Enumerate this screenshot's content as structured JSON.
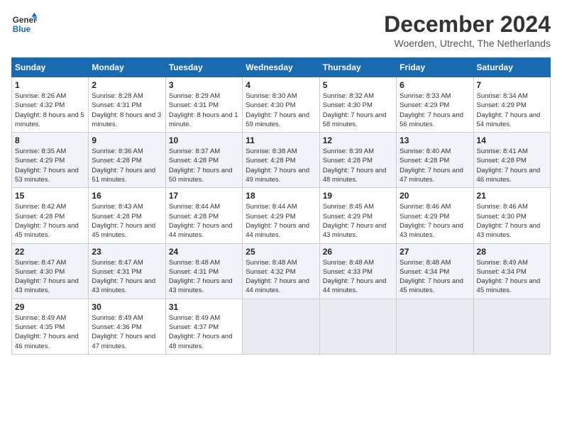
{
  "header": {
    "logo_line1": "General",
    "logo_line2": "Blue",
    "month_title": "December 2024",
    "location": "Woerden, Utrecht, The Netherlands"
  },
  "days_of_week": [
    "Sunday",
    "Monday",
    "Tuesday",
    "Wednesday",
    "Thursday",
    "Friday",
    "Saturday"
  ],
  "weeks": [
    [
      {
        "day": "1",
        "sunrise": "8:26 AM",
        "sunset": "4:32 PM",
        "daylight": "8 hours and 5 minutes."
      },
      {
        "day": "2",
        "sunrise": "8:28 AM",
        "sunset": "4:31 PM",
        "daylight": "8 hours and 3 minutes."
      },
      {
        "day": "3",
        "sunrise": "8:29 AM",
        "sunset": "4:31 PM",
        "daylight": "8 hours and 1 minute."
      },
      {
        "day": "4",
        "sunrise": "8:30 AM",
        "sunset": "4:30 PM",
        "daylight": "7 hours and 59 minutes."
      },
      {
        "day": "5",
        "sunrise": "8:32 AM",
        "sunset": "4:30 PM",
        "daylight": "7 hours and 58 minutes."
      },
      {
        "day": "6",
        "sunrise": "8:33 AM",
        "sunset": "4:29 PM",
        "daylight": "7 hours and 56 minutes."
      },
      {
        "day": "7",
        "sunrise": "8:34 AM",
        "sunset": "4:29 PM",
        "daylight": "7 hours and 54 minutes."
      }
    ],
    [
      {
        "day": "8",
        "sunrise": "8:35 AM",
        "sunset": "4:29 PM",
        "daylight": "7 hours and 53 minutes."
      },
      {
        "day": "9",
        "sunrise": "8:36 AM",
        "sunset": "4:28 PM",
        "daylight": "7 hours and 51 minutes."
      },
      {
        "day": "10",
        "sunrise": "8:37 AM",
        "sunset": "4:28 PM",
        "daylight": "7 hours and 50 minutes."
      },
      {
        "day": "11",
        "sunrise": "8:38 AM",
        "sunset": "4:28 PM",
        "daylight": "7 hours and 49 minutes."
      },
      {
        "day": "12",
        "sunrise": "8:39 AM",
        "sunset": "4:28 PM",
        "daylight": "7 hours and 48 minutes."
      },
      {
        "day": "13",
        "sunrise": "8:40 AM",
        "sunset": "4:28 PM",
        "daylight": "7 hours and 47 minutes."
      },
      {
        "day": "14",
        "sunrise": "8:41 AM",
        "sunset": "4:28 PM",
        "daylight": "7 hours and 46 minutes."
      }
    ],
    [
      {
        "day": "15",
        "sunrise": "8:42 AM",
        "sunset": "4:28 PM",
        "daylight": "7 hours and 45 minutes."
      },
      {
        "day": "16",
        "sunrise": "8:43 AM",
        "sunset": "4:28 PM",
        "daylight": "7 hours and 45 minutes."
      },
      {
        "day": "17",
        "sunrise": "8:44 AM",
        "sunset": "4:28 PM",
        "daylight": "7 hours and 44 minutes."
      },
      {
        "day": "18",
        "sunrise": "8:44 AM",
        "sunset": "4:29 PM",
        "daylight": "7 hours and 44 minutes."
      },
      {
        "day": "19",
        "sunrise": "8:45 AM",
        "sunset": "4:29 PM",
        "daylight": "7 hours and 43 minutes."
      },
      {
        "day": "20",
        "sunrise": "8:46 AM",
        "sunset": "4:29 PM",
        "daylight": "7 hours and 43 minutes."
      },
      {
        "day": "21",
        "sunrise": "8:46 AM",
        "sunset": "4:30 PM",
        "daylight": "7 hours and 43 minutes."
      }
    ],
    [
      {
        "day": "22",
        "sunrise": "8:47 AM",
        "sunset": "4:30 PM",
        "daylight": "7 hours and 43 minutes."
      },
      {
        "day": "23",
        "sunrise": "8:47 AM",
        "sunset": "4:31 PM",
        "daylight": "7 hours and 43 minutes."
      },
      {
        "day": "24",
        "sunrise": "8:48 AM",
        "sunset": "4:31 PM",
        "daylight": "7 hours and 43 minutes."
      },
      {
        "day": "25",
        "sunrise": "8:48 AM",
        "sunset": "4:32 PM",
        "daylight": "7 hours and 44 minutes."
      },
      {
        "day": "26",
        "sunrise": "8:48 AM",
        "sunset": "4:33 PM",
        "daylight": "7 hours and 44 minutes."
      },
      {
        "day": "27",
        "sunrise": "8:48 AM",
        "sunset": "4:34 PM",
        "daylight": "7 hours and 45 minutes."
      },
      {
        "day": "28",
        "sunrise": "8:49 AM",
        "sunset": "4:34 PM",
        "daylight": "7 hours and 45 minutes."
      }
    ],
    [
      {
        "day": "29",
        "sunrise": "8:49 AM",
        "sunset": "4:35 PM",
        "daylight": "7 hours and 46 minutes."
      },
      {
        "day": "30",
        "sunrise": "8:49 AM",
        "sunset": "4:36 PM",
        "daylight": "7 hours and 47 minutes."
      },
      {
        "day": "31",
        "sunrise": "8:49 AM",
        "sunset": "4:37 PM",
        "daylight": "7 hours and 48 minutes."
      },
      null,
      null,
      null,
      null
    ]
  ]
}
